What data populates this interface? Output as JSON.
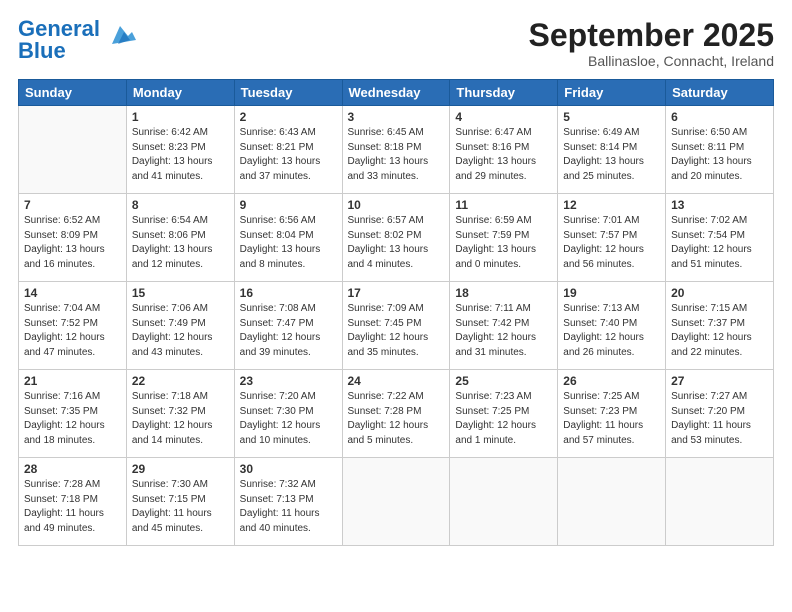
{
  "header": {
    "logo_line1": "General",
    "logo_line2": "Blue",
    "month": "September 2025",
    "location": "Ballinasloe, Connacht, Ireland"
  },
  "weekdays": [
    "Sunday",
    "Monday",
    "Tuesday",
    "Wednesday",
    "Thursday",
    "Friday",
    "Saturday"
  ],
  "weeks": [
    [
      {
        "day": "",
        "info": ""
      },
      {
        "day": "1",
        "info": "Sunrise: 6:42 AM\nSunset: 8:23 PM\nDaylight: 13 hours\nand 41 minutes."
      },
      {
        "day": "2",
        "info": "Sunrise: 6:43 AM\nSunset: 8:21 PM\nDaylight: 13 hours\nand 37 minutes."
      },
      {
        "day": "3",
        "info": "Sunrise: 6:45 AM\nSunset: 8:18 PM\nDaylight: 13 hours\nand 33 minutes."
      },
      {
        "day": "4",
        "info": "Sunrise: 6:47 AM\nSunset: 8:16 PM\nDaylight: 13 hours\nand 29 minutes."
      },
      {
        "day": "5",
        "info": "Sunrise: 6:49 AM\nSunset: 8:14 PM\nDaylight: 13 hours\nand 25 minutes."
      },
      {
        "day": "6",
        "info": "Sunrise: 6:50 AM\nSunset: 8:11 PM\nDaylight: 13 hours\nand 20 minutes."
      }
    ],
    [
      {
        "day": "7",
        "info": "Sunrise: 6:52 AM\nSunset: 8:09 PM\nDaylight: 13 hours\nand 16 minutes."
      },
      {
        "day": "8",
        "info": "Sunrise: 6:54 AM\nSunset: 8:06 PM\nDaylight: 13 hours\nand 12 minutes."
      },
      {
        "day": "9",
        "info": "Sunrise: 6:56 AM\nSunset: 8:04 PM\nDaylight: 13 hours\nand 8 minutes."
      },
      {
        "day": "10",
        "info": "Sunrise: 6:57 AM\nSunset: 8:02 PM\nDaylight: 13 hours\nand 4 minutes."
      },
      {
        "day": "11",
        "info": "Sunrise: 6:59 AM\nSunset: 7:59 PM\nDaylight: 13 hours\nand 0 minutes."
      },
      {
        "day": "12",
        "info": "Sunrise: 7:01 AM\nSunset: 7:57 PM\nDaylight: 12 hours\nand 56 minutes."
      },
      {
        "day": "13",
        "info": "Sunrise: 7:02 AM\nSunset: 7:54 PM\nDaylight: 12 hours\nand 51 minutes."
      }
    ],
    [
      {
        "day": "14",
        "info": "Sunrise: 7:04 AM\nSunset: 7:52 PM\nDaylight: 12 hours\nand 47 minutes."
      },
      {
        "day": "15",
        "info": "Sunrise: 7:06 AM\nSunset: 7:49 PM\nDaylight: 12 hours\nand 43 minutes."
      },
      {
        "day": "16",
        "info": "Sunrise: 7:08 AM\nSunset: 7:47 PM\nDaylight: 12 hours\nand 39 minutes."
      },
      {
        "day": "17",
        "info": "Sunrise: 7:09 AM\nSunset: 7:45 PM\nDaylight: 12 hours\nand 35 minutes."
      },
      {
        "day": "18",
        "info": "Sunrise: 7:11 AM\nSunset: 7:42 PM\nDaylight: 12 hours\nand 31 minutes."
      },
      {
        "day": "19",
        "info": "Sunrise: 7:13 AM\nSunset: 7:40 PM\nDaylight: 12 hours\nand 26 minutes."
      },
      {
        "day": "20",
        "info": "Sunrise: 7:15 AM\nSunset: 7:37 PM\nDaylight: 12 hours\nand 22 minutes."
      }
    ],
    [
      {
        "day": "21",
        "info": "Sunrise: 7:16 AM\nSunset: 7:35 PM\nDaylight: 12 hours\nand 18 minutes."
      },
      {
        "day": "22",
        "info": "Sunrise: 7:18 AM\nSunset: 7:32 PM\nDaylight: 12 hours\nand 14 minutes."
      },
      {
        "day": "23",
        "info": "Sunrise: 7:20 AM\nSunset: 7:30 PM\nDaylight: 12 hours\nand 10 minutes."
      },
      {
        "day": "24",
        "info": "Sunrise: 7:22 AM\nSunset: 7:28 PM\nDaylight: 12 hours\nand 5 minutes."
      },
      {
        "day": "25",
        "info": "Sunrise: 7:23 AM\nSunset: 7:25 PM\nDaylight: 12 hours\nand 1 minute."
      },
      {
        "day": "26",
        "info": "Sunrise: 7:25 AM\nSunset: 7:23 PM\nDaylight: 11 hours\nand 57 minutes."
      },
      {
        "day": "27",
        "info": "Sunrise: 7:27 AM\nSunset: 7:20 PM\nDaylight: 11 hours\nand 53 minutes."
      }
    ],
    [
      {
        "day": "28",
        "info": "Sunrise: 7:28 AM\nSunset: 7:18 PM\nDaylight: 11 hours\nand 49 minutes."
      },
      {
        "day": "29",
        "info": "Sunrise: 7:30 AM\nSunset: 7:15 PM\nDaylight: 11 hours\nand 45 minutes."
      },
      {
        "day": "30",
        "info": "Sunrise: 7:32 AM\nSunset: 7:13 PM\nDaylight: 11 hours\nand 40 minutes."
      },
      {
        "day": "",
        "info": ""
      },
      {
        "day": "",
        "info": ""
      },
      {
        "day": "",
        "info": ""
      },
      {
        "day": "",
        "info": ""
      }
    ]
  ]
}
